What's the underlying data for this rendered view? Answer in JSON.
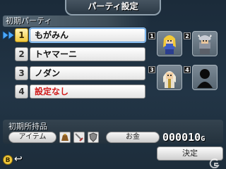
{
  "header": {
    "title": "パーティ設定"
  },
  "party": {
    "heading": "初期パーティ",
    "slots": [
      {
        "number": "1",
        "name": "もがみん",
        "empty": false
      },
      {
        "number": "2",
        "name": "トヤマーニ",
        "empty": false
      },
      {
        "number": "3",
        "name": "ノダン",
        "empty": false
      },
      {
        "number": "4",
        "name": "設定なし",
        "empty": true
      }
    ],
    "portraits": [
      {
        "badge": "1",
        "icon": "blonde-hero-sprite-icon"
      },
      {
        "badge": "2",
        "icon": "helmeted-knight-sprite-icon"
      },
      {
        "badge": "3",
        "icon": "priest-sprite-icon"
      },
      {
        "badge": "4",
        "icon": "empty-silhouette-icon"
      }
    ]
  },
  "items": {
    "heading": "初期所持品",
    "item_label": "アイテム",
    "item_icons": [
      "pouch-icon",
      "sword-icon",
      "shield-icon"
    ],
    "money_label": "お金",
    "money_value": "000010",
    "money_unit": "G"
  },
  "footer": {
    "b_button": "B",
    "ok_label": "決定"
  },
  "colors": {
    "background": "#223546",
    "empty_slot_text": "#d01b1b",
    "selected_accent": "#f1c93c"
  }
}
